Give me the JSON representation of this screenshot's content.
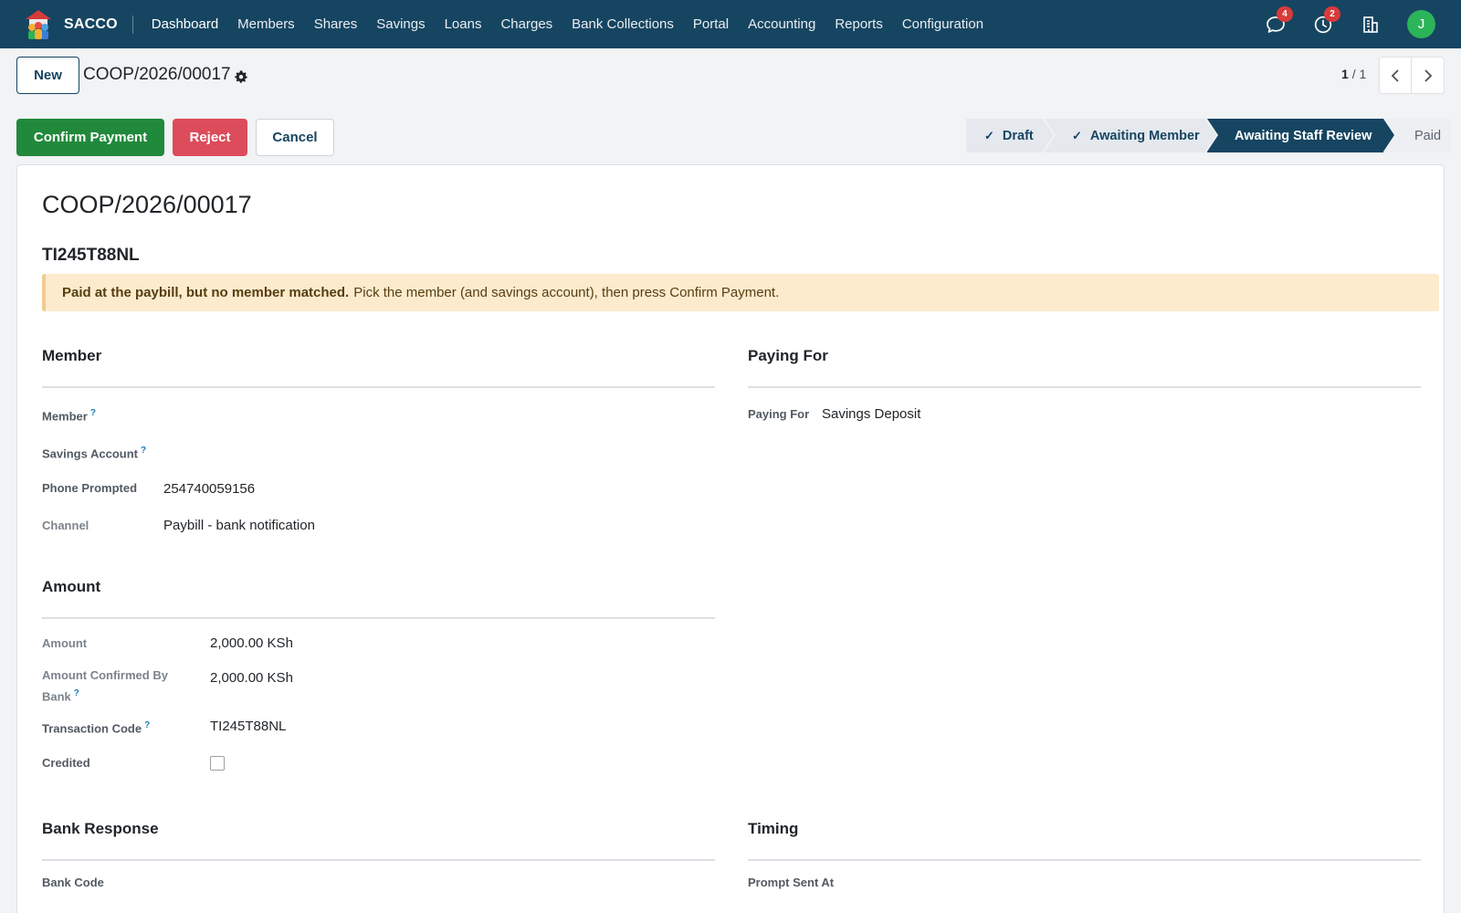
{
  "navbar": {
    "brand": "SACCO",
    "menu": [
      "Dashboard",
      "Members",
      "Shares",
      "Savings",
      "Loans",
      "Charges",
      "Bank Collections",
      "Portal",
      "Accounting",
      "Reports",
      "Configuration"
    ],
    "messages_count": "4",
    "activities_count": "2",
    "avatar_initial": "J",
    "colors": {
      "navbar": "#164561",
      "avatar": "#2bb45a",
      "badge": "#d93a3a"
    }
  },
  "control": {
    "new_label": "New",
    "breadcrumb": "COOP/2026/00017",
    "pager_current": "1",
    "pager_total": "/ 1"
  },
  "actions": {
    "confirm_label": "Confirm Payment",
    "reject_label": "Reject",
    "cancel_label": "Cancel"
  },
  "statusbar": {
    "stages": [
      {
        "label": "Draft",
        "state": "done"
      },
      {
        "label": "Awaiting Member",
        "state": "done"
      },
      {
        "label": "Awaiting Staff Review",
        "state": "current"
      },
      {
        "label": "Paid",
        "state": "todo"
      }
    ],
    "check_glyph": "✓"
  },
  "form": {
    "title": "COOP/2026/00017",
    "subtitle": "TI245T88NL",
    "alert_bold": "Paid at the paybill, but no member matched.",
    "alert_text": "Pick the member (and savings account), then press Confirm Payment.",
    "member_section": {
      "title": "Member",
      "member_label": "Member",
      "savings_label": "Savings Account",
      "phone_label": "Phone Prompted",
      "phone_value": "254740059156",
      "channel_label": "Channel",
      "channel_value": "Paybill - bank notification"
    },
    "paying_section": {
      "title": "Paying For",
      "paying_label": "Paying For",
      "paying_value": "Savings Deposit"
    },
    "amount_section": {
      "title": "Amount",
      "amount_label": "Amount",
      "amount_value": "2,000.00 KSh",
      "confirmed_label_1": "Amount Confirmed By",
      "confirmed_label_2": "Bank",
      "confirmed_value": "2,000.00 KSh",
      "txn_label": "Transaction Code",
      "txn_value": "TI245T88NL",
      "credited_label": "Credited",
      "credited_checked": false
    },
    "bank_section": {
      "title": "Bank Response",
      "bank_code_label": "Bank Code"
    },
    "timing_section": {
      "title": "Timing",
      "prompt_label": "Prompt Sent At"
    },
    "help_mark": "?"
  }
}
